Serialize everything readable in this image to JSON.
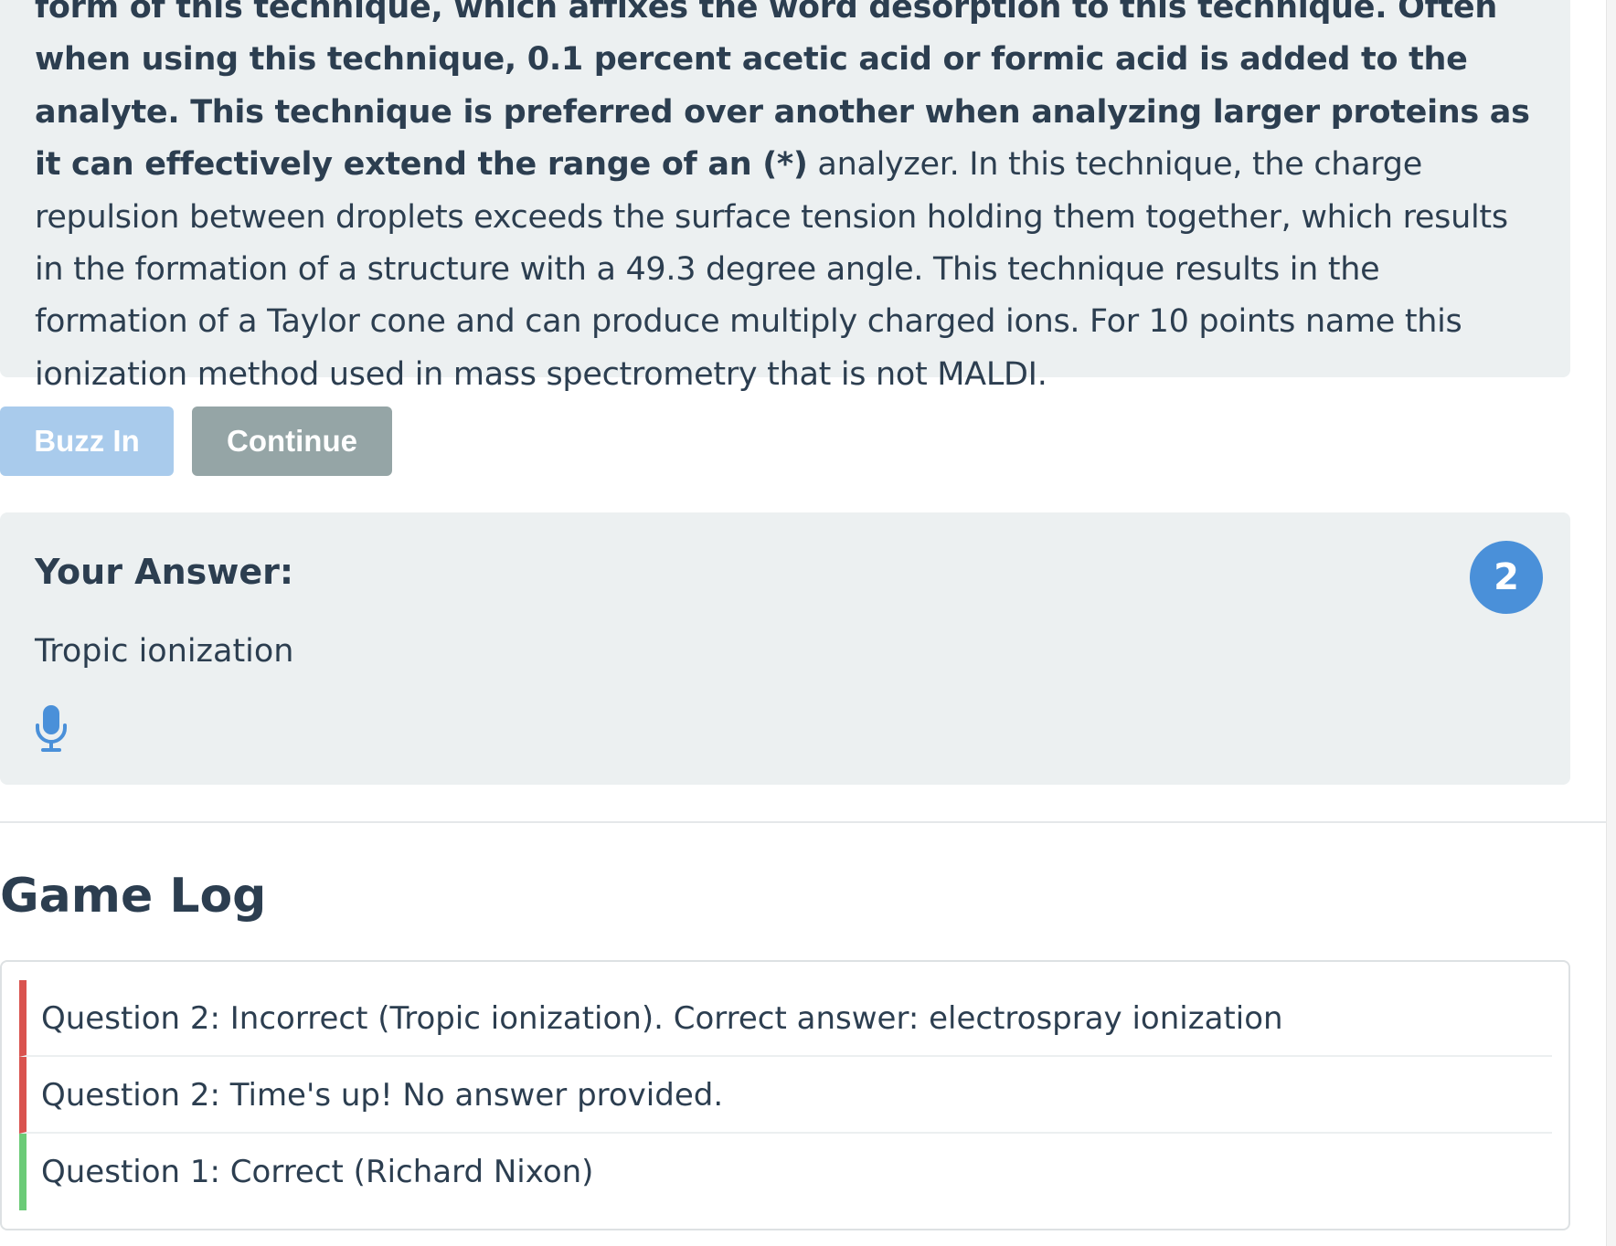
{
  "question": {
    "text_bold_1": "form of this technique, which affixes the word desorption to this technique. Often when using this technique, 0.1 percent acetic acid or formic acid is added to the analyte. This technique is preferred over another when analyzing larger proteins as it can effectively extend the range of an (*)",
    "text_plain": " analyzer. In this technique, the charge repulsion between droplets exceeds the surface tension holding them together, which results in the formation of a structure with a 49.3 degree angle. This technique results in the formation of a Taylor cone and can produce multiply charged ions. For 10 points name this ionization method used in mass spectrometry that is not MALDI."
  },
  "buttons": {
    "buzz_in": "Buzz In",
    "continue": "Continue"
  },
  "answer": {
    "heading": "Your Answer:",
    "value": "Tropic ionization",
    "question_number": "2",
    "mic_icon": "microphone-icon"
  },
  "game_log": {
    "title": "Game Log",
    "entries": [
      {
        "text": "Question 2: Incorrect (Tropic ionization). Correct answer: electrospray ionization",
        "status": "incorrect"
      },
      {
        "text": "Question 2: Time's up! No answer provided.",
        "status": "incorrect"
      },
      {
        "text": "Question 1: Correct (Richard Nixon)",
        "status": "correct"
      }
    ]
  },
  "colors": {
    "accent_blue": "#4a90d9",
    "buzz_disabled": "#a9cbec",
    "continue_gray": "#95a5a6",
    "incorrect_red": "#d9534f",
    "correct_green": "#6bcb77",
    "panel_bg": "#ecf0f1",
    "text_dark": "#2c3e50"
  }
}
